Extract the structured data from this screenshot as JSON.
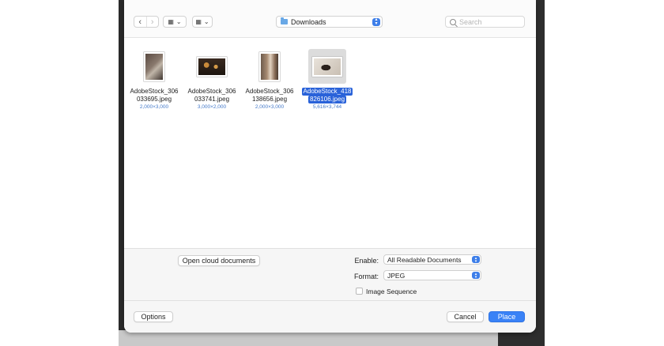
{
  "toolbar": {
    "back_glyph": "‹",
    "forward_glyph": "›",
    "view_glyph": "▦",
    "chevron": "⌄",
    "location": "Downloads",
    "search_placeholder": "Search"
  },
  "files": [
    {
      "name_line1": "AdobeStock_306",
      "name_line2": "033695.jpeg",
      "dimensions": "2,000×3,000",
      "selected": false
    },
    {
      "name_line1": "AdobeStock_306",
      "name_line2": "033741.jpeg",
      "dimensions": "3,000×2,000",
      "selected": false
    },
    {
      "name_line1": "AdobeStock_306",
      "name_line2": "138656.jpeg",
      "dimensions": "2,000×3,000",
      "selected": false
    },
    {
      "name_line1": "AdobeStock_418",
      "name_line2": "826106.jpeg",
      "dimensions": "5,616×3,744",
      "selected": true
    }
  ],
  "options": {
    "cloud_button": "Open cloud documents",
    "enable_label": "Enable:",
    "enable_value": "All Readable Documents",
    "format_label": "Format:",
    "format_value": "JPEG",
    "image_sequence_label": "Image Sequence",
    "image_sequence_checked": false
  },
  "footer": {
    "options_button": "Options",
    "cancel_button": "Cancel",
    "place_button": "Place"
  },
  "colors": {
    "accent": "#3a82f6",
    "selection": "#2962d9",
    "dimension_text": "#4479c9"
  }
}
